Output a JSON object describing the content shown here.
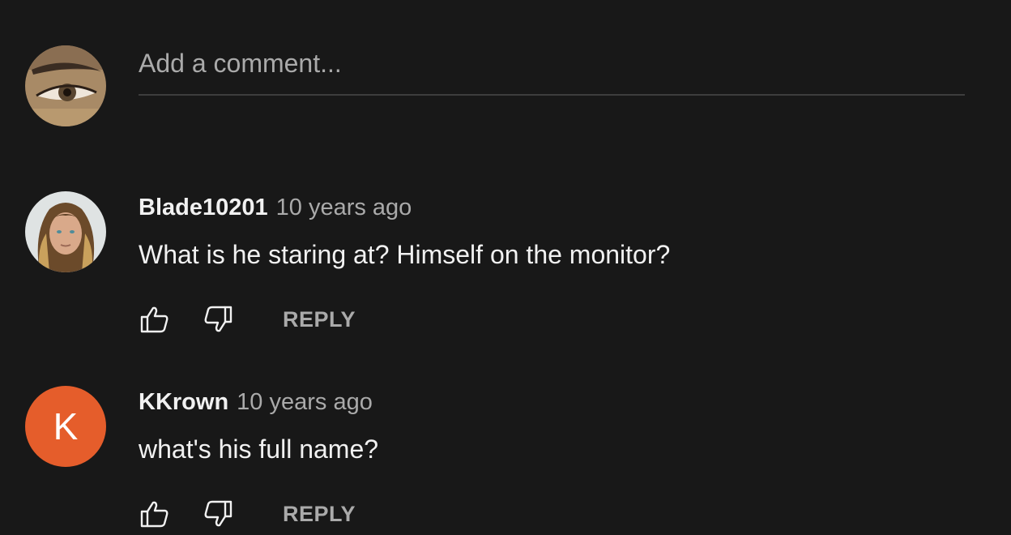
{
  "composer": {
    "placeholder": "Add a comment..."
  },
  "comments": [
    {
      "author": "Blade10201",
      "time": "10 years ago",
      "text": "What is he staring at? Himself on the monitor?",
      "reply_label": "REPLY"
    },
    {
      "author": "KKrown",
      "time": "10 years ago",
      "text": "what's his full name?",
      "avatar_letter": "K",
      "avatar_color": "#e55d2b",
      "reply_label": "REPLY"
    }
  ],
  "colors": {
    "background": "#181818",
    "text_primary": "#f1f1f1",
    "text_secondary": "#aaaaaa",
    "divider": "#3d3d3d"
  }
}
